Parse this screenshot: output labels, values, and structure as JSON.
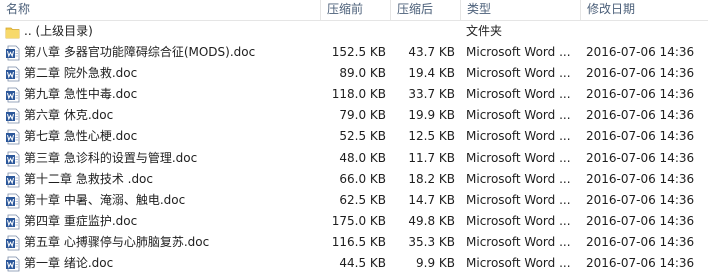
{
  "columns": {
    "name": "名称",
    "compressed": "压缩前",
    "original": "压缩后",
    "type": "类型",
    "modified": "修改日期"
  },
  "parent_row": {
    "name": ".. (上级目录)",
    "type": "文件夹",
    "icon": "folder-icon"
  },
  "files": [
    {
      "name": "第八章  多器官功能障碍综合征(MODS).doc",
      "before": "152.5 KB",
      "after": "43.7 KB",
      "type": "Microsoft Word ...",
      "date": "2016-07-06 14:36"
    },
    {
      "name": "第二章  院外急救.doc",
      "before": "89.0 KB",
      "after": "19.4 KB",
      "type": "Microsoft Word ...",
      "date": "2016-07-06 14:36"
    },
    {
      "name": "第九章  急性中毒.doc",
      "before": "118.0 KB",
      "after": "33.7 KB",
      "type": "Microsoft Word ...",
      "date": "2016-07-06 14:36"
    },
    {
      "name": "第六章  休克.doc",
      "before": "79.0 KB",
      "after": "19.9 KB",
      "type": "Microsoft Word ...",
      "date": "2016-07-06 14:36"
    },
    {
      "name": "第七章  急性心梗.doc",
      "before": "52.5 KB",
      "after": "12.5 KB",
      "type": "Microsoft Word ...",
      "date": "2016-07-06 14:36"
    },
    {
      "name": "第三章  急诊科的设置与管理.doc",
      "before": "48.0 KB",
      "after": "11.7 KB",
      "type": "Microsoft Word ...",
      "date": "2016-07-06 14:36"
    },
    {
      "name": "第十二章  急救技术 .doc",
      "before": "66.0 KB",
      "after": "18.2 KB",
      "type": "Microsoft Word ...",
      "date": "2016-07-06 14:36"
    },
    {
      "name": "第十章  中暑、淹溺、触电.doc",
      "before": "62.5 KB",
      "after": "14.7 KB",
      "type": "Microsoft Word ...",
      "date": "2016-07-06 14:36"
    },
    {
      "name": "第四章  重症监护.doc",
      "before": "175.0 KB",
      "after": "49.8 KB",
      "type": "Microsoft Word ...",
      "date": "2016-07-06 14:36"
    },
    {
      "name": "第五章  心搏骤停与心肺脑复苏.doc",
      "before": "116.5 KB",
      "after": "35.3 KB",
      "type": "Microsoft Word ...",
      "date": "2016-07-06 14:36"
    },
    {
      "name": "第一章  绪论.doc",
      "before": "44.5 KB",
      "after": "9.9 KB",
      "type": "Microsoft Word ...",
      "date": "2016-07-06 14:36"
    }
  ],
  "colors": {
    "header_text": "#4c607a",
    "word_icon": "#2b579a",
    "folder": "#f2c94c"
  }
}
